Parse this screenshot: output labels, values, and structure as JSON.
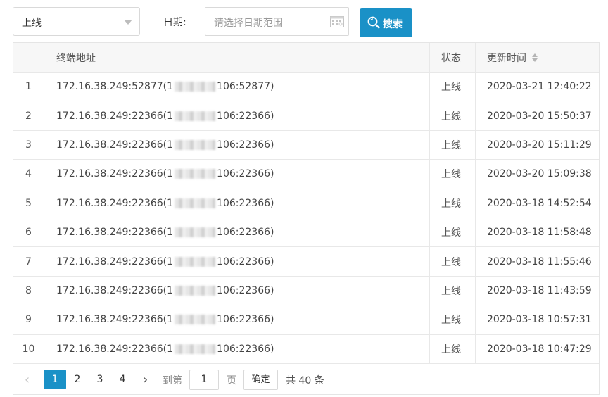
{
  "filters": {
    "status_value": "上线",
    "date_label": "日期:",
    "date_placeholder": "请选择日期范围",
    "search_label": "搜索"
  },
  "table": {
    "columns": {
      "index": "",
      "address": "终端地址",
      "status": "状态",
      "time": "更新时间"
    },
    "rows": [
      {
        "index": "1",
        "addr_prefix": "172.16.38.249:52877(1",
        "addr_suffix": "106:52877)",
        "status": "上线",
        "time": "2020-03-21 12:40:22"
      },
      {
        "index": "2",
        "addr_prefix": "172.16.38.249:22366(1",
        "addr_suffix": "106:22366)",
        "status": "上线",
        "time": "2020-03-20 15:50:37"
      },
      {
        "index": "3",
        "addr_prefix": "172.16.38.249:22366(1",
        "addr_suffix": "106:22366)",
        "status": "上线",
        "time": "2020-03-20 15:11:29"
      },
      {
        "index": "4",
        "addr_prefix": "172.16.38.249:22366(1",
        "addr_suffix": "106:22366)",
        "status": "上线",
        "time": "2020-03-20 15:09:38"
      },
      {
        "index": "5",
        "addr_prefix": "172.16.38.249:22366(1",
        "addr_suffix": "106:22366)",
        "status": "上线",
        "time": "2020-03-18 14:52:54"
      },
      {
        "index": "6",
        "addr_prefix": "172.16.38.249:22366(1",
        "addr_suffix": "106:22366)",
        "status": "上线",
        "time": "2020-03-18 11:58:48"
      },
      {
        "index": "7",
        "addr_prefix": "172.16.38.249:22366(1",
        "addr_suffix": "106:22366)",
        "status": "上线",
        "time": "2020-03-18 11:55:46"
      },
      {
        "index": "8",
        "addr_prefix": "172.16.38.249:22366(1",
        "addr_suffix": "106:22366)",
        "status": "上线",
        "time": "2020-03-18 11:43:59"
      },
      {
        "index": "9",
        "addr_prefix": "172.16.38.249:22366(1",
        "addr_suffix": "106:22366)",
        "status": "上线",
        "time": "2020-03-18 10:57:31"
      },
      {
        "index": "10",
        "addr_prefix": "172.16.38.249:22366(1",
        "addr_suffix": "106:22366)",
        "status": "上线",
        "time": "2020-03-18 10:47:29"
      }
    ]
  },
  "pagination": {
    "prev_icon": "chevron-left-icon",
    "pages": [
      "1",
      "2",
      "3",
      "4"
    ],
    "current": "1",
    "next_icon": "chevron-right-icon",
    "goto_label": "到第",
    "goto_value": "1",
    "page_unit": "页",
    "confirm_label": "确定",
    "total_label": "共 40 条"
  },
  "colors": {
    "primary": "#1a91c7",
    "header_bg": "#f7f7f7",
    "border": "#e5e5e5"
  }
}
